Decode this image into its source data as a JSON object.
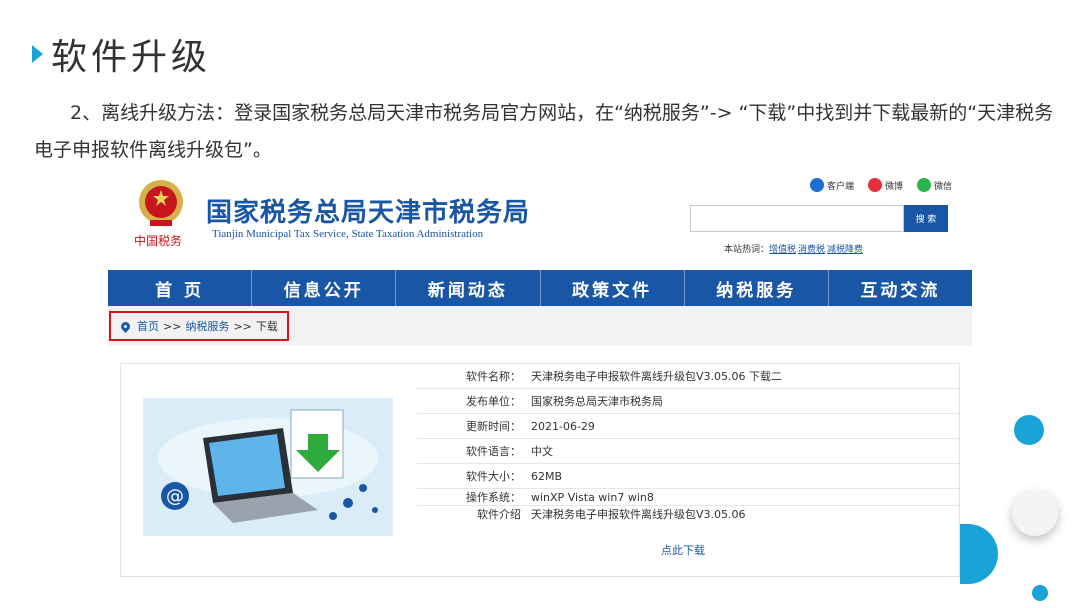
{
  "slide": {
    "title": "软件升级",
    "paragraph": "2、离线升级方法：登录国家税务总局天津市税务局官方网站，在“纳税服务”-> “下载”中找到并下载最新的“天津税务电子申报软件离线升级包”。"
  },
  "site": {
    "emblem_caption": "中国税务",
    "name": "国家税务总局天津市税务局",
    "subtitle": "Tianjin Municipal Tax Service, State Taxation Administration",
    "social": [
      {
        "label": "客户端",
        "icon": "phone-app-icon",
        "color": "#1b6fd3"
      },
      {
        "label": "微博",
        "icon": "weibo-icon",
        "color": "#e6303a"
      },
      {
        "label": "微信",
        "icon": "wechat-icon",
        "color": "#2ab54a"
      }
    ],
    "search": {
      "placeholder": "",
      "button_label": "搜 索"
    },
    "hot_label": "本站热词：",
    "hot_words": [
      "增值税",
      "消费税",
      "减税降费"
    ],
    "nav": [
      "首 页",
      "信息公开",
      "新闻动态",
      "政策文件",
      "纳税服务",
      "互动交流"
    ],
    "breadcrumb": {
      "home": "首页",
      "sep": ">>",
      "section": "纳税服务",
      "current": "下载"
    }
  },
  "software": {
    "rows": [
      {
        "label": "软件名称：",
        "value": "天津税务电子申报软件离线升级包V3.05.06 下载二"
      },
      {
        "label": "发布单位：",
        "value": "国家税务总局天津市税务局"
      },
      {
        "label": "更新时间：",
        "value": "2021-06-29"
      },
      {
        "label": "软件语言：",
        "value": "中文"
      },
      {
        "label": "软件大小：",
        "value": "62MB"
      },
      {
        "label": "操作系统：",
        "value": "winXP Vista win7 win8"
      },
      {
        "label": "软件介绍",
        "value": "天津税务电子申报软件离线升级包V3.05.06"
      }
    ],
    "download_label": "点此下载"
  },
  "colors": {
    "brand": "#1a56a6",
    "highlight": "#d6151b",
    "accent": "#1aa3d6"
  }
}
